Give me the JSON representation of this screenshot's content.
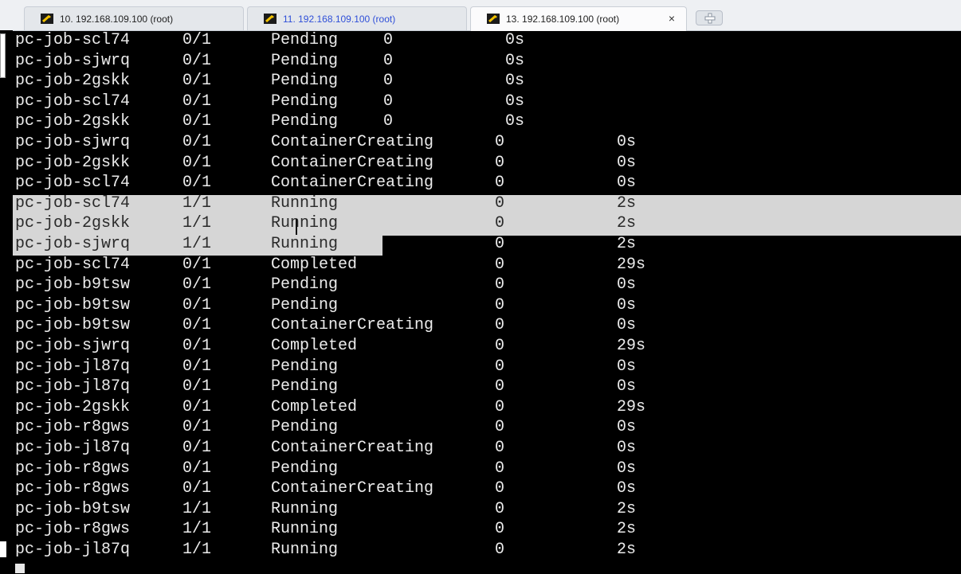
{
  "tabs": [
    {
      "label": "10. 192.168.109.100 (root)",
      "active": false,
      "link": false
    },
    {
      "label": "11. 192.168.109.100 (root)",
      "active": false,
      "link": true
    },
    {
      "label": "13. 192.168.109.100 (root)",
      "active": true,
      "link": false
    }
  ],
  "icons": {
    "tab": "terminal-session-icon",
    "close": "close-icon",
    "new_tab": "plus-icon"
  },
  "tab_close_glyph": "×",
  "colors": {
    "terminal_bg": "#000000",
    "terminal_fg": "#ececec",
    "selection": "#d6d6d6",
    "tab_link": "#2f4fd8"
  },
  "terminal": {
    "rows": [
      {
        "name": "pc-job-scl74",
        "ready": "0/1",
        "status": "Pending",
        "restarts": "0",
        "age": "0s",
        "layout": "a"
      },
      {
        "name": "pc-job-sjwrq",
        "ready": "0/1",
        "status": "Pending",
        "restarts": "0",
        "age": "0s",
        "layout": "a"
      },
      {
        "name": "pc-job-2gskk",
        "ready": "0/1",
        "status": "Pending",
        "restarts": "0",
        "age": "0s",
        "layout": "a"
      },
      {
        "name": "pc-job-scl74",
        "ready": "0/1",
        "status": "Pending",
        "restarts": "0",
        "age": "0s",
        "layout": "a"
      },
      {
        "name": "pc-job-2gskk",
        "ready": "0/1",
        "status": "Pending",
        "restarts": "0",
        "age": "0s",
        "layout": "a"
      },
      {
        "name": "pc-job-sjwrq",
        "ready": "0/1",
        "status": "ContainerCreating",
        "restarts": "0",
        "age": "0s",
        "layout": "b"
      },
      {
        "name": "pc-job-2gskk",
        "ready": "0/1",
        "status": "ContainerCreating",
        "restarts": "0",
        "age": "0s",
        "layout": "b"
      },
      {
        "name": "pc-job-scl74",
        "ready": "0/1",
        "status": "ContainerCreating",
        "restarts": "0",
        "age": "0s",
        "layout": "b"
      },
      {
        "name": "pc-job-scl74",
        "ready": "1/1",
        "status": "Running",
        "restarts": "0",
        "age": "2s",
        "layout": "b",
        "sel": "full"
      },
      {
        "name": "pc-job-2gskk",
        "ready": "1/1",
        "status": "Running",
        "restarts": "0",
        "age": "2s",
        "layout": "b",
        "sel": "full"
      },
      {
        "name": "pc-job-sjwrq",
        "ready": "1/1",
        "status": "Running",
        "restarts": "0",
        "age": "2s",
        "layout": "b",
        "sel": "partial"
      },
      {
        "name": "pc-job-scl74",
        "ready": "0/1",
        "status": "Completed",
        "restarts": "0",
        "age": "29s",
        "layout": "b"
      },
      {
        "name": "pc-job-b9tsw",
        "ready": "0/1",
        "status": "Pending",
        "restarts": "0",
        "age": "0s",
        "layout": "b"
      },
      {
        "name": "pc-job-b9tsw",
        "ready": "0/1",
        "status": "Pending",
        "restarts": "0",
        "age": "0s",
        "layout": "b"
      },
      {
        "name": "pc-job-b9tsw",
        "ready": "0/1",
        "status": "ContainerCreating",
        "restarts": "0",
        "age": "0s",
        "layout": "b"
      },
      {
        "name": "pc-job-sjwrq",
        "ready": "0/1",
        "status": "Completed",
        "restarts": "0",
        "age": "29s",
        "layout": "b"
      },
      {
        "name": "pc-job-jl87q",
        "ready": "0/1",
        "status": "Pending",
        "restarts": "0",
        "age": "0s",
        "layout": "b"
      },
      {
        "name": "pc-job-jl87q",
        "ready": "0/1",
        "status": "Pending",
        "restarts": "0",
        "age": "0s",
        "layout": "b"
      },
      {
        "name": "pc-job-2gskk",
        "ready": "0/1",
        "status": "Completed",
        "restarts": "0",
        "age": "29s",
        "layout": "b"
      },
      {
        "name": "pc-job-r8gws",
        "ready": "0/1",
        "status": "Pending",
        "restarts": "0",
        "age": "0s",
        "layout": "b"
      },
      {
        "name": "pc-job-jl87q",
        "ready": "0/1",
        "status": "ContainerCreating",
        "restarts": "0",
        "age": "0s",
        "layout": "b"
      },
      {
        "name": "pc-job-r8gws",
        "ready": "0/1",
        "status": "Pending",
        "restarts": "0",
        "age": "0s",
        "layout": "b"
      },
      {
        "name": "pc-job-r8gws",
        "ready": "0/1",
        "status": "ContainerCreating",
        "restarts": "0",
        "age": "0s",
        "layout": "b"
      },
      {
        "name": "pc-job-b9tsw",
        "ready": "1/1",
        "status": "Running",
        "restarts": "0",
        "age": "2s",
        "layout": "b"
      },
      {
        "name": "pc-job-r8gws",
        "ready": "1/1",
        "status": "Running",
        "restarts": "0",
        "age": "2s",
        "layout": "b"
      },
      {
        "name": "pc-job-jl87q",
        "ready": "1/1",
        "status": "Running",
        "restarts": "0",
        "age": "2s",
        "layout": "b"
      }
    ]
  }
}
